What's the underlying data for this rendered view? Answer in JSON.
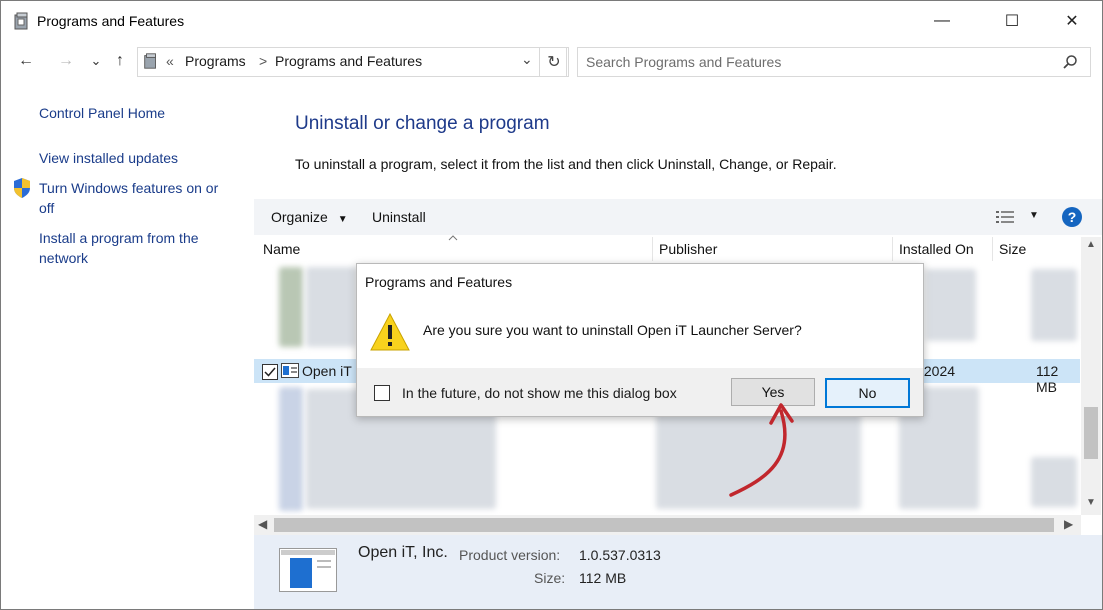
{
  "window": {
    "title": "Programs and Features",
    "controls": {
      "minimize": "—",
      "maximize": "☐",
      "close": "✕"
    }
  },
  "nav": {
    "back": "←",
    "forward": "→",
    "recent": "⌄",
    "up": "↑",
    "breadcrumb_sep": "«",
    "breadcrumbs": [
      "Programs",
      "Programs and Features"
    ],
    "chevron": ">",
    "dropdown": "⌄",
    "refresh": "↻",
    "search_placeholder": "Search Programs and Features"
  },
  "sidebar": {
    "home": "Control Panel Home",
    "updates": "View installed updates",
    "features_line1": "Turn Windows features on or",
    "features_line2": "off",
    "install_line1": "Install a program from the",
    "install_line2": "network"
  },
  "main": {
    "heading": "Uninstall or change a program",
    "instruction": "To uninstall a program, select it from the list and then click Uninstall, Change, or Repair."
  },
  "toolbar": {
    "organize": "Organize",
    "uninstall": "Uninstall",
    "help": "?"
  },
  "columns": {
    "name": "Name",
    "publisher": "Publisher",
    "installed_on": "Installed On",
    "size": "Size"
  },
  "selected_row": {
    "name": "Open iT",
    "installed_on": "/2024",
    "size": "112 MB"
  },
  "details": {
    "publisher": "Open iT, Inc.",
    "product_version_label": "Product version:",
    "product_version": "1.0.537.0313",
    "size_label": "Size:",
    "size": "112 MB"
  },
  "dialog": {
    "title": "Programs and Features",
    "message": "Are you sure you want to uninstall Open iT Launcher Server?",
    "dont_show": "In the future, do not show me this dialog box",
    "yes": "Yes",
    "no": "No"
  },
  "colors": {
    "link": "#1a3c8a",
    "heading": "#1e3a8a",
    "selection": "#cce4f7",
    "accent_arrow": "#c1272d"
  }
}
